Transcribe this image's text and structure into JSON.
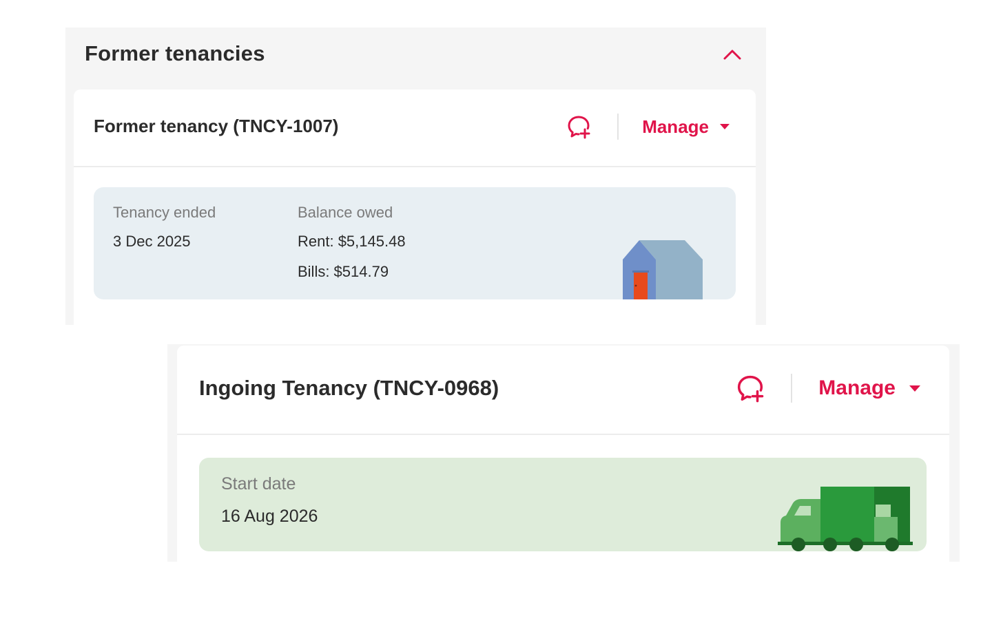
{
  "former_section": {
    "title": "Former tenancies",
    "collapse_icon": "chevron-up-icon",
    "card": {
      "title": "Former tenancy (TNCY-1007)",
      "chat_icon": "chat-add-icon",
      "manage_label": "Manage",
      "ended_label": "Tenancy ended",
      "ended_value": "3 Dec 2025",
      "balance_label": "Balance owed",
      "rent_value": "Rent: $5,145.48",
      "bills_value": "Bills: $514.79",
      "illustration": "house-icon"
    }
  },
  "ingoing_card": {
    "title": "Ingoing Tenancy (TNCY-0968)",
    "chat_icon": "chat-add-icon",
    "manage_label": "Manage",
    "start_label": "Start date",
    "start_value": "16 Aug 2026",
    "illustration": "truck-icon"
  },
  "colors": {
    "accent": "#e0144a",
    "former_box": "#e8eff3",
    "ingoing_box": "#deecda",
    "panel_bg": "#f5f5f5"
  }
}
